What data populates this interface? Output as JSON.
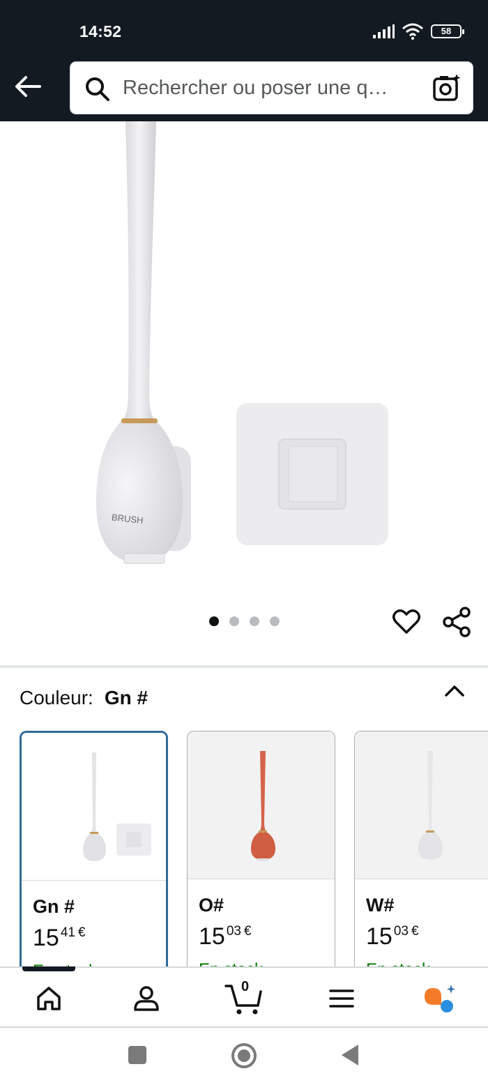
{
  "status_bar": {
    "time": "14:52",
    "battery": "58"
  },
  "search": {
    "placeholder": "Rechercher ou poser une q…"
  },
  "product": {
    "image_label": "BRUSH",
    "carousel_count": 4,
    "carousel_active": 1
  },
  "color_selector": {
    "label": "Couleur:",
    "selected": "Gn #",
    "options": [
      {
        "name": "Gn #",
        "price_whole": "15",
        "price_fraction": "41",
        "currency": "€",
        "stock": "En stock",
        "color": "#e8e8ea"
      },
      {
        "name": "O#",
        "price_whole": "15",
        "price_fraction": "03",
        "currency": "€",
        "stock": "En stock",
        "color": "#d4644a"
      },
      {
        "name": "W#",
        "price_whole": "15",
        "price_fraction": "03",
        "currency": "€",
        "stock": "En stock",
        "color": "#ececee"
      }
    ]
  },
  "bottom_nav": {
    "cart_count": "0"
  },
  "colors": {
    "header_bg": "#131a22",
    "selected_border": "#2f6b99",
    "stock_green": "#007600",
    "assistant_orange": "#f47c28",
    "assistant_blue": "#2b8dde"
  }
}
